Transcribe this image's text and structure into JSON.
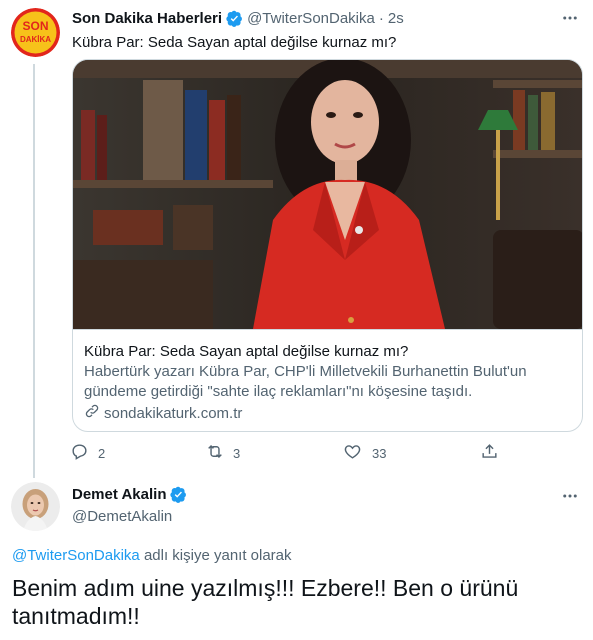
{
  "tweet": {
    "author_name": "Son Dakika Haberleri",
    "author_handle": "@TwiterSonDakika",
    "time": "2s",
    "text": "Kübra Par: Seda Sayan aptal değilse kurnaz mı?",
    "card": {
      "title": "Kübra Par: Seda Sayan aptal değilse kurnaz mı?",
      "description": "Habertürk yazarı Kübra Par, CHP'li Milletvekili Burhanettin Bulut'un gündeme getirdiği \"sahte ilaç reklamları\"nı köşesine taşıdı.",
      "domain": "sondakikaturk.com.tr"
    },
    "actions": {
      "replies": "2",
      "retweets": "3",
      "likes": "33"
    },
    "logo_text": "SON DAKİKA"
  },
  "reply": {
    "author_name": "Demet Akalin",
    "author_handle": "@DemetAkalin",
    "reply_to_handle": "@TwiterSonDakika",
    "reply_to_suffix": " adlı kişiye yanıt olarak",
    "text": "Benim adım uine yazılmış!!! Ezbere!! Ben o ürünü tanıtmadım!!"
  },
  "colors": {
    "accent": "#1d9bf0",
    "secondary_text": "#536471",
    "border": "#cfd9de"
  },
  "icons": [
    "verified-badge-icon",
    "more-options-icon",
    "link-icon",
    "reply-icon",
    "retweet-icon",
    "like-icon",
    "share-icon"
  ]
}
